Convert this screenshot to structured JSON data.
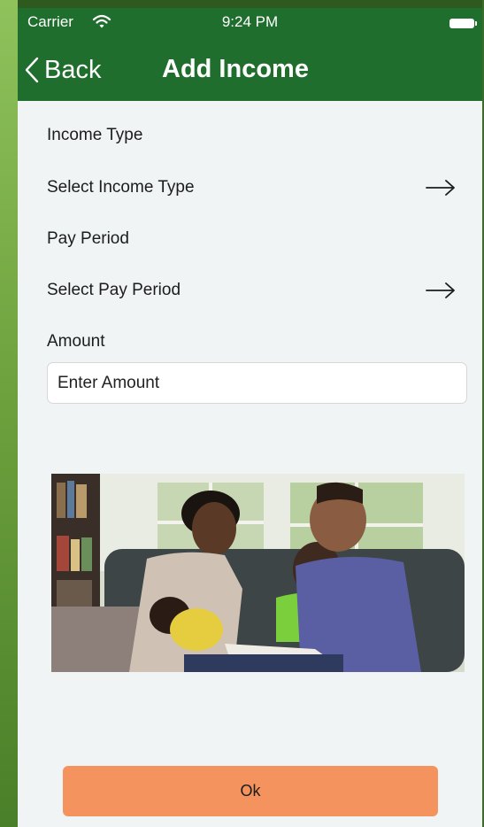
{
  "status_bar": {
    "carrier": "Carrier",
    "time": "9:24 PM"
  },
  "nav": {
    "back_label": "Back",
    "title": "Add Income"
  },
  "form": {
    "income_type": {
      "label": "Income Type",
      "select_text": "Select Income Type"
    },
    "pay_period": {
      "label": "Pay Period",
      "select_text": "Select Pay Period"
    },
    "amount": {
      "label": "Amount",
      "placeholder": "Enter Amount",
      "value": ""
    }
  },
  "photo": {
    "subject": "family-reading-on-couch"
  },
  "actions": {
    "ok_label": "Ok"
  },
  "colors": {
    "header_green": "#1f6e2e",
    "background": "#f1f4f5",
    "ok_button": "#f5935f"
  }
}
